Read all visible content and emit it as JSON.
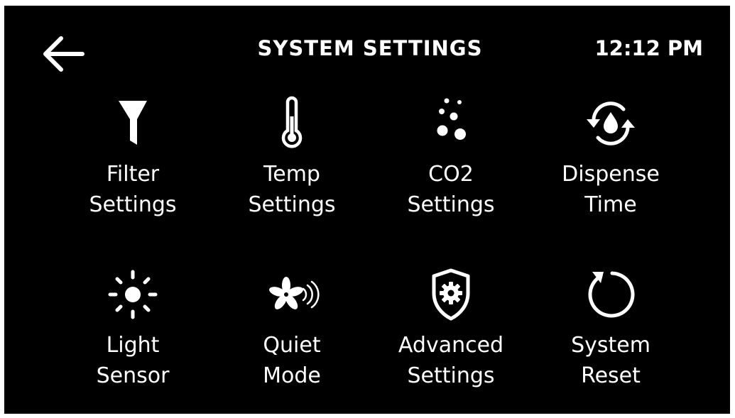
{
  "header": {
    "back_icon": "arrow-left-icon",
    "title": "SYSTEM SETTINGS",
    "time": "12:12 PM"
  },
  "colors": {
    "background": "#000000",
    "foreground": "#ffffff"
  },
  "tiles": [
    {
      "icon": "filter-funnel-icon",
      "line1": "Filter",
      "line2": "Settings"
    },
    {
      "icon": "thermometer-icon",
      "line1": "Temp",
      "line2": "Settings"
    },
    {
      "icon": "bubbles-icon",
      "line1": "CO2",
      "line2": "Settings"
    },
    {
      "icon": "droplet-cycle-icon",
      "line1": "Dispense",
      "line2": "Time"
    },
    {
      "icon": "sun-icon",
      "line1": "Light",
      "line2": "Sensor"
    },
    {
      "icon": "fan-sound-icon",
      "line1": "Quiet",
      "line2": "Mode"
    },
    {
      "icon": "shield-gear-icon",
      "line1": "Advanced",
      "line2": "Settings"
    },
    {
      "icon": "reset-circle-icon",
      "line1": "System",
      "line2": "Reset"
    }
  ]
}
